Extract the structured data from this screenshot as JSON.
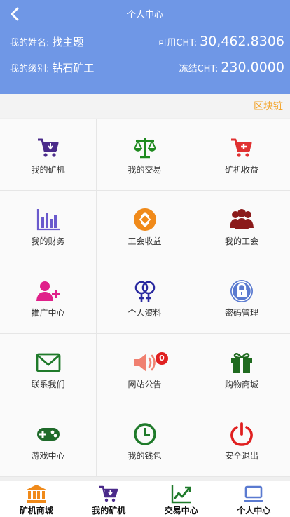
{
  "header": {
    "title": "个人中心",
    "name_label": "我的姓名:",
    "name_value": "找主题",
    "level_label": "我的级别:",
    "level_value": "钻石矿工",
    "available_label": "可用CHT:",
    "available_value": "30,462.8306",
    "frozen_label": "冻结CHT:",
    "frozen_value": "230.0000"
  },
  "chain_link": "区块链",
  "grid": [
    {
      "label": "我的矿机",
      "icon": "cart-icon",
      "color": "#4a2a8a"
    },
    {
      "label": "我的交易",
      "icon": "scale-icon",
      "color": "#1f8a1f"
    },
    {
      "label": "矿机收益",
      "icon": "cart-plus-icon",
      "color": "#e03030"
    },
    {
      "label": "我的财务",
      "icon": "bar-chart-icon",
      "color": "#6a5acd"
    },
    {
      "label": "工会收益",
      "icon": "coin-icon",
      "color": "#f08a1a"
    },
    {
      "label": "我的工会",
      "icon": "users-icon",
      "color": "#8b1a1a"
    },
    {
      "label": "推广中心",
      "icon": "user-plus-icon",
      "color": "#e0208a"
    },
    {
      "label": "个人资料",
      "icon": "gender-icon",
      "color": "#2a2aa0"
    },
    {
      "label": "密码管理",
      "icon": "lock-icon",
      "color": "#5a7ad0"
    },
    {
      "label": "联系我们",
      "icon": "envelope-icon",
      "color": "#1f7a2a"
    },
    {
      "label": "网站公告",
      "icon": "speaker-icon",
      "color": "#f08070",
      "badge": "0"
    },
    {
      "label": "购物商城",
      "icon": "gift-icon",
      "color": "#1f6a1f"
    },
    {
      "label": "游戏中心",
      "icon": "gamepad-icon",
      "color": "#1f6a2a"
    },
    {
      "label": "我的钱包",
      "icon": "clock-icon",
      "color": "#1f7a2a"
    },
    {
      "label": "安全退出",
      "icon": "power-icon",
      "color": "#e02020"
    }
  ],
  "tabs": [
    {
      "label": "矿机商城",
      "icon": "bank-icon",
      "color": "#f08a1a"
    },
    {
      "label": "我的矿机",
      "icon": "cart-icon",
      "color": "#4a2a8a"
    },
    {
      "label": "交易中心",
      "icon": "trend-chart-icon",
      "color": "#1f7a2a"
    },
    {
      "label": "个人中心",
      "icon": "laptop-icon",
      "color": "#5a7ad0"
    }
  ]
}
